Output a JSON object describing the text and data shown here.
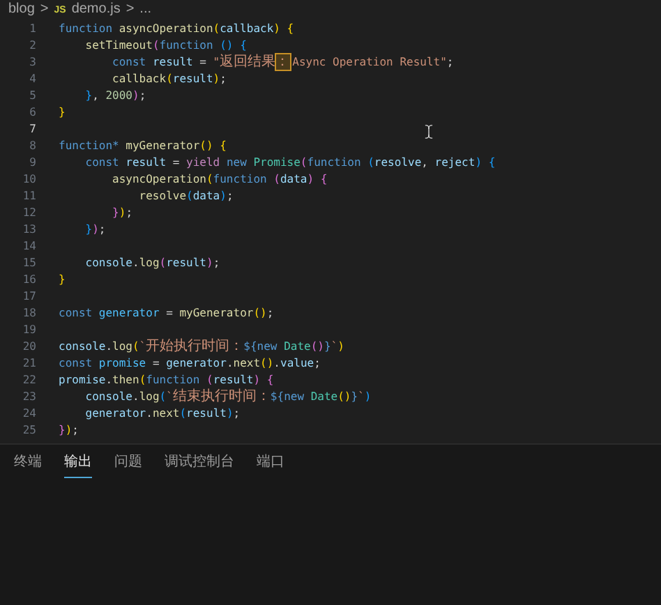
{
  "breadcrumb": {
    "folder": "blog",
    "separator": ">",
    "file_badge": "JS",
    "file": "demo.js",
    "more": "..."
  },
  "editor": {
    "lines": [
      {
        "number": "1",
        "current": false,
        "tokens": [
          {
            "kind": "kw",
            "text": "function"
          },
          {
            "kind": "fn",
            "text": " asyncOperation"
          },
          {
            "kind": "b1",
            "text": "("
          },
          {
            "kind": "var",
            "text": "callback"
          },
          {
            "kind": "b1",
            "text": ")"
          },
          {
            "kind": "b1",
            "text": " {"
          }
        ]
      },
      {
        "number": "2",
        "current": false,
        "tokens": [
          {
            "kind": "fn",
            "text": "    setTimeout"
          },
          {
            "kind": "b2",
            "text": "("
          },
          {
            "kind": "kw",
            "text": "function"
          },
          {
            "kind": "b3",
            "text": " ()"
          },
          {
            "kind": "b3",
            "text": " {"
          }
        ]
      },
      {
        "number": "3",
        "current": false,
        "tokens": [
          {
            "kind": "kw",
            "text": "        const"
          },
          {
            "kind": "var",
            "text": " result"
          },
          {
            "kind": "p",
            "text": " = "
          },
          {
            "kind": "str",
            "text": "\""
          },
          {
            "kind": "cjk",
            "text": "返回结果"
          },
          {
            "kind": "hl",
            "text": "："
          },
          {
            "kind": "str",
            "text": "Async Operation Result\""
          },
          {
            "kind": "p",
            "text": ";"
          }
        ]
      },
      {
        "number": "4",
        "current": false,
        "tokens": [
          {
            "kind": "fn",
            "text": "        callback"
          },
          {
            "kind": "b1",
            "text": "("
          },
          {
            "kind": "var",
            "text": "result"
          },
          {
            "kind": "b1",
            "text": ")"
          },
          {
            "kind": "p",
            "text": ";"
          }
        ]
      },
      {
        "number": "5",
        "current": false,
        "tokens": [
          {
            "kind": "b3",
            "text": "    }"
          },
          {
            "kind": "p",
            "text": ", "
          },
          {
            "kind": "num",
            "text": "2000"
          },
          {
            "kind": "b2",
            "text": ")"
          },
          {
            "kind": "p",
            "text": ";"
          }
        ]
      },
      {
        "number": "6",
        "current": false,
        "tokens": [
          {
            "kind": "b1",
            "text": "}"
          }
        ]
      },
      {
        "number": "7",
        "current": true
      },
      {
        "number": "8",
        "current": false,
        "tokens": [
          {
            "kind": "kw",
            "text": "function*"
          },
          {
            "kind": "fn",
            "text": " myGenerator"
          },
          {
            "kind": "b1",
            "text": "()"
          },
          {
            "kind": "b1",
            "text": " {"
          }
        ]
      },
      {
        "number": "9",
        "current": false,
        "tokens": [
          {
            "kind": "kw",
            "text": "    const"
          },
          {
            "kind": "var",
            "text": " result"
          },
          {
            "kind": "p",
            "text": " = "
          },
          {
            "kind": "ctl",
            "text": "yield"
          },
          {
            "kind": "kw",
            "text": " new"
          },
          {
            "kind": "cls",
            "text": " Promise"
          },
          {
            "kind": "b2",
            "text": "("
          },
          {
            "kind": "kw",
            "text": "function"
          },
          {
            "kind": "b3",
            "text": " ("
          },
          {
            "kind": "var",
            "text": "resolve"
          },
          {
            "kind": "p",
            "text": ", "
          },
          {
            "kind": "var",
            "text": "reject"
          },
          {
            "kind": "b3",
            "text": ")"
          },
          {
            "kind": "b3",
            "text": " {"
          }
        ]
      },
      {
        "number": "10",
        "current": false,
        "tokens": [
          {
            "kind": "fn",
            "text": "        asyncOperation"
          },
          {
            "kind": "b1",
            "text": "("
          },
          {
            "kind": "kw",
            "text": "function"
          },
          {
            "kind": "b2",
            "text": " ("
          },
          {
            "kind": "var",
            "text": "data"
          },
          {
            "kind": "b2",
            "text": ")"
          },
          {
            "kind": "b2",
            "text": " {"
          }
        ]
      },
      {
        "number": "11",
        "current": false,
        "tokens": [
          {
            "kind": "fn",
            "text": "            resolve"
          },
          {
            "kind": "b3",
            "text": "("
          },
          {
            "kind": "var",
            "text": "data"
          },
          {
            "kind": "b3",
            "text": ")"
          },
          {
            "kind": "p",
            "text": ";"
          }
        ]
      },
      {
        "number": "12",
        "current": false,
        "tokens": [
          {
            "kind": "b2",
            "text": "        }"
          },
          {
            "kind": "b1",
            "text": ")"
          },
          {
            "kind": "p",
            "text": ";"
          }
        ]
      },
      {
        "number": "13",
        "current": false,
        "tokens": [
          {
            "kind": "b3",
            "text": "    }"
          },
          {
            "kind": "b2",
            "text": ")"
          },
          {
            "kind": "p",
            "text": ";"
          }
        ]
      },
      {
        "number": "14",
        "current": false
      },
      {
        "number": "15",
        "current": false,
        "tokens": [
          {
            "kind": "var",
            "text": "    console"
          },
          {
            "kind": "p",
            "text": "."
          },
          {
            "kind": "fn",
            "text": "log"
          },
          {
            "kind": "b2",
            "text": "("
          },
          {
            "kind": "var",
            "text": "result"
          },
          {
            "kind": "b2",
            "text": ")"
          },
          {
            "kind": "p",
            "text": ";"
          }
        ]
      },
      {
        "number": "16",
        "current": false,
        "tokens": [
          {
            "kind": "b1",
            "text": "}"
          }
        ]
      },
      {
        "number": "17",
        "current": false
      },
      {
        "number": "18",
        "current": false,
        "tokens": [
          {
            "kind": "kw",
            "text": "const"
          },
          {
            "kind": "cst",
            "text": " generator"
          },
          {
            "kind": "p",
            "text": " = "
          },
          {
            "kind": "fn",
            "text": "myGenerator"
          },
          {
            "kind": "b1",
            "text": "()"
          },
          {
            "kind": "p",
            "text": ";"
          }
        ]
      },
      {
        "number": "19",
        "current": false
      },
      {
        "number": "20",
        "current": false,
        "tokens": [
          {
            "kind": "var",
            "text": "console"
          },
          {
            "kind": "p",
            "text": "."
          },
          {
            "kind": "fn",
            "text": "log"
          },
          {
            "kind": "b1",
            "text": "("
          },
          {
            "kind": "str",
            "text": "`"
          },
          {
            "kind": "cjk",
            "text": "开始执行时间："
          },
          {
            "kind": "tpl",
            "text": "${"
          },
          {
            "kind": "kw",
            "text": "new"
          },
          {
            "kind": "cls",
            "text": " Date"
          },
          {
            "kind": "b2",
            "text": "()"
          },
          {
            "kind": "tpl",
            "text": "}"
          },
          {
            "kind": "str",
            "text": "`"
          },
          {
            "kind": "b1",
            "text": ")"
          }
        ]
      },
      {
        "number": "21",
        "current": false,
        "tokens": [
          {
            "kind": "kw",
            "text": "const"
          },
          {
            "kind": "cst",
            "text": " promise"
          },
          {
            "kind": "p",
            "text": " = "
          },
          {
            "kind": "var",
            "text": "generator"
          },
          {
            "kind": "p",
            "text": "."
          },
          {
            "kind": "fn",
            "text": "next"
          },
          {
            "kind": "b1",
            "text": "()"
          },
          {
            "kind": "p",
            "text": "."
          },
          {
            "kind": "var",
            "text": "value"
          },
          {
            "kind": "p",
            "text": ";"
          }
        ]
      },
      {
        "number": "22",
        "current": false,
        "tokens": [
          {
            "kind": "var",
            "text": "promise"
          },
          {
            "kind": "p",
            "text": "."
          },
          {
            "kind": "fn",
            "text": "then"
          },
          {
            "kind": "b1",
            "text": "("
          },
          {
            "kind": "kw",
            "text": "function"
          },
          {
            "kind": "b2",
            "text": " ("
          },
          {
            "kind": "var",
            "text": "result"
          },
          {
            "kind": "b2",
            "text": ")"
          },
          {
            "kind": "b2",
            "text": " {"
          }
        ]
      },
      {
        "number": "23",
        "current": false,
        "tokens": [
          {
            "kind": "var",
            "text": "    console"
          },
          {
            "kind": "p",
            "text": "."
          },
          {
            "kind": "fn",
            "text": "log"
          },
          {
            "kind": "b3",
            "text": "("
          },
          {
            "kind": "str",
            "text": "`"
          },
          {
            "kind": "cjk",
            "text": "结束执行时间："
          },
          {
            "kind": "tpl",
            "text": "${"
          },
          {
            "kind": "kw",
            "text": "new"
          },
          {
            "kind": "cls",
            "text": " Date"
          },
          {
            "kind": "b1",
            "text": "()"
          },
          {
            "kind": "tpl",
            "text": "}"
          },
          {
            "kind": "str",
            "text": "`"
          },
          {
            "kind": "b3",
            "text": ")"
          }
        ]
      },
      {
        "number": "24",
        "current": false,
        "tokens": [
          {
            "kind": "var",
            "text": "    generator"
          },
          {
            "kind": "p",
            "text": "."
          },
          {
            "kind": "fn",
            "text": "next"
          },
          {
            "kind": "b3",
            "text": "("
          },
          {
            "kind": "var",
            "text": "result"
          },
          {
            "kind": "b3",
            "text": ")"
          },
          {
            "kind": "p",
            "text": ";"
          }
        ]
      },
      {
        "number": "25",
        "current": false,
        "tokens": [
          {
            "kind": "b2",
            "text": "}"
          },
          {
            "kind": "b1",
            "text": ")"
          },
          {
            "kind": "p",
            "text": ";"
          }
        ]
      }
    ]
  },
  "panel": {
    "tabs": [
      {
        "label": "终端",
        "selected": false
      },
      {
        "label": "输出",
        "selected": true
      },
      {
        "label": "问题",
        "selected": false
      },
      {
        "label": "调试控制台",
        "selected": false
      },
      {
        "label": "端口",
        "selected": false
      }
    ]
  }
}
